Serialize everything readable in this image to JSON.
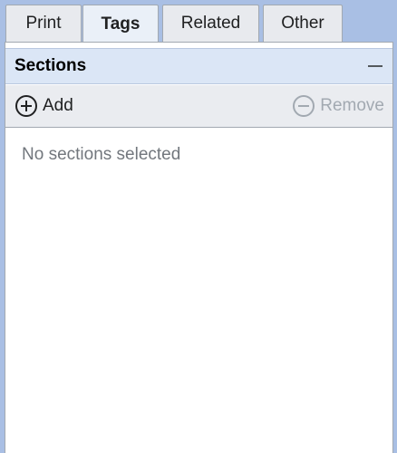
{
  "tabs": [
    {
      "label": "Print",
      "active": false
    },
    {
      "label": "Tags",
      "active": true
    },
    {
      "label": "Related",
      "active": false
    },
    {
      "label": "Other",
      "active": false
    }
  ],
  "section": {
    "title": "Sections",
    "collapse_icon": "minus-icon"
  },
  "toolbar": {
    "add_label": "Add",
    "add_icon": "plus-circle-icon",
    "remove_label": "Remove",
    "remove_icon": "minus-circle-icon",
    "remove_disabled": true
  },
  "content": {
    "empty_message": "No sections selected"
  },
  "colors": {
    "background": "#a9bfe4",
    "header_bg": "#dbe6f6",
    "toolbar_bg": "#eaecf0",
    "disabled_text": "#a2a9b1",
    "muted_text": "#72777d"
  }
}
